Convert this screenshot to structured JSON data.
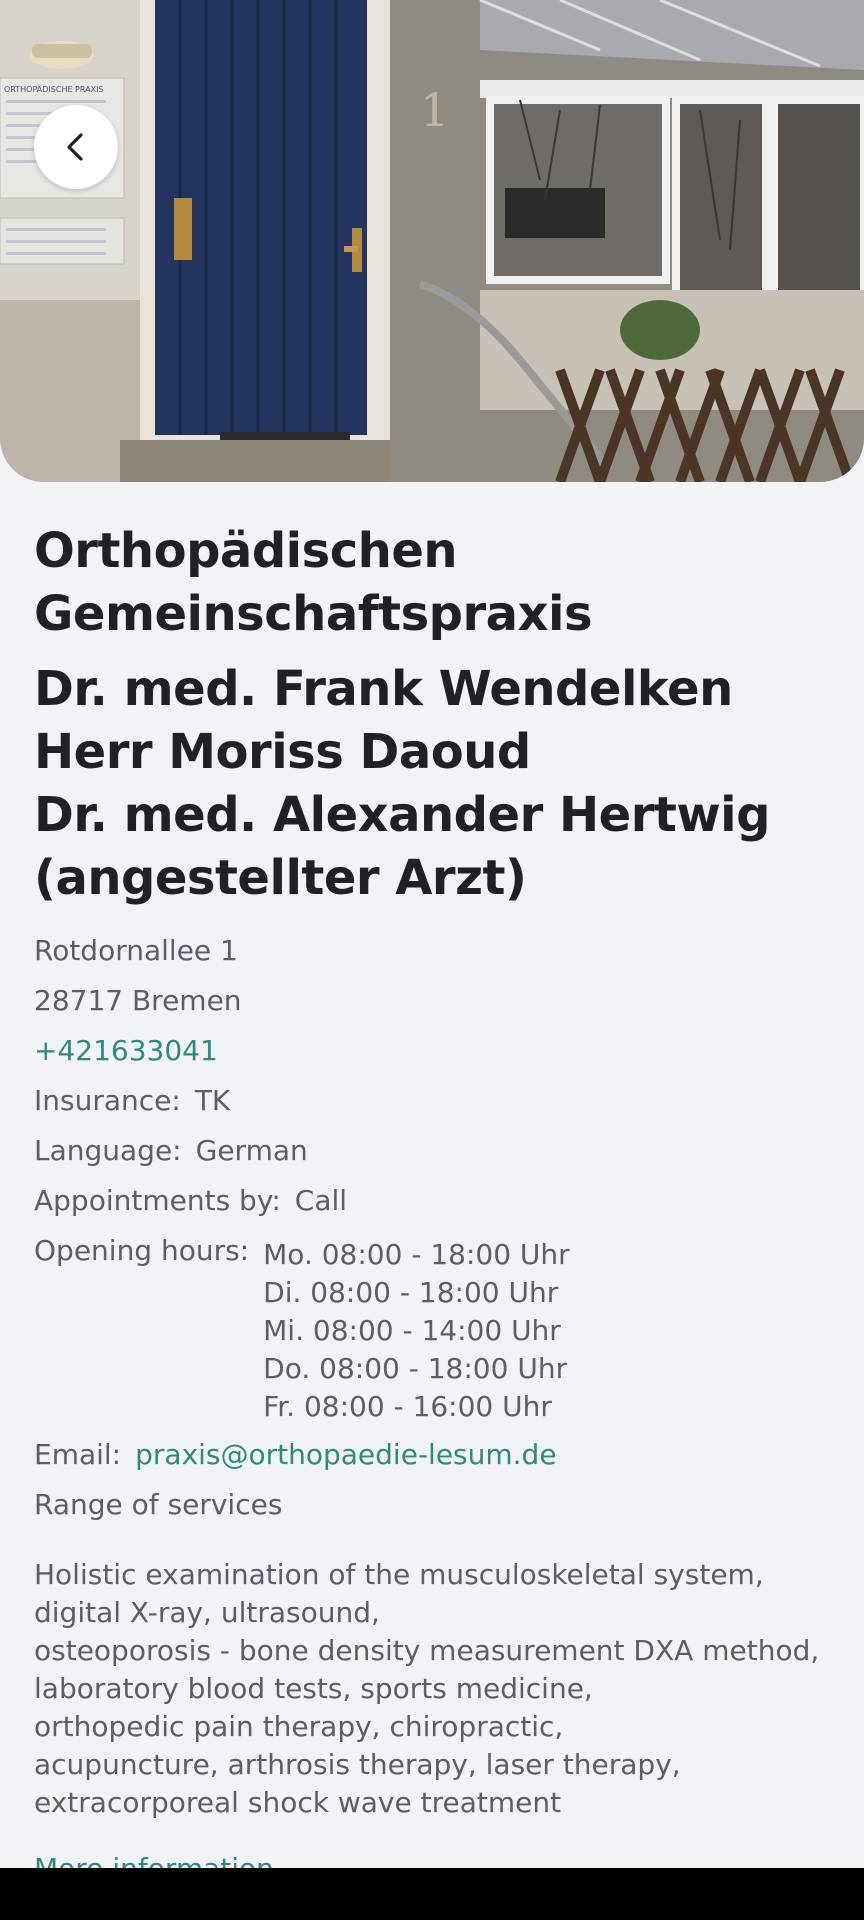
{
  "practice": {
    "title": "Orthopädischen Gemeinschaftspraxis",
    "doctors": [
      "Dr. med. Frank Wendelken",
      "Herr Moriss Daoud",
      "Dr. med. Alexander Hertwig",
      "(angestellter Arzt)"
    ],
    "address_line1": "Rotdornallee 1",
    "address_line2": "28717 Bremen",
    "phone": "+421633041"
  },
  "details": {
    "insurance_label": "Insurance:",
    "insurance_value": "TK",
    "language_label": "Language:",
    "language_value": "German",
    "appointments_label": "Appointments by:",
    "appointments_value": "Call",
    "hours_label": "Opening hours:",
    "hours": [
      "Mo. 08:00 - 18:00 Uhr",
      "Di. 08:00 - 18:00 Uhr",
      "Mi. 08:00 - 14:00 Uhr",
      "Do. 08:00 - 18:00 Uhr",
      "Fr. 08:00 - 16:00 Uhr"
    ],
    "email_label": "Email:",
    "email_value": "praxis@orthopaedie-lesum.de",
    "services_heading": "Range of services"
  },
  "services_text": [
    "Holistic examination of the musculoskeletal system,",
    "digital X-ray, ultrasound,",
    "osteoporosis - bone density measurement DXA method,",
    "laboratory blood tests, sports medicine,",
    "orthopedic pain therapy, chiropractic,",
    "acupuncture, arthrosis therapy, laser therapy,",
    "extracorporeal shock wave treatment"
  ],
  "more_info_label": "More information",
  "hero_sign": "ORTHOPÄDISCHE PRAXIS",
  "hero_house_number": "1",
  "icons": {
    "back": "chevron-left-icon"
  },
  "colors": {
    "accent": "#2f8a7c",
    "text": "#1f2126",
    "muted": "#5b5e66",
    "background": "#f2f3f7"
  }
}
